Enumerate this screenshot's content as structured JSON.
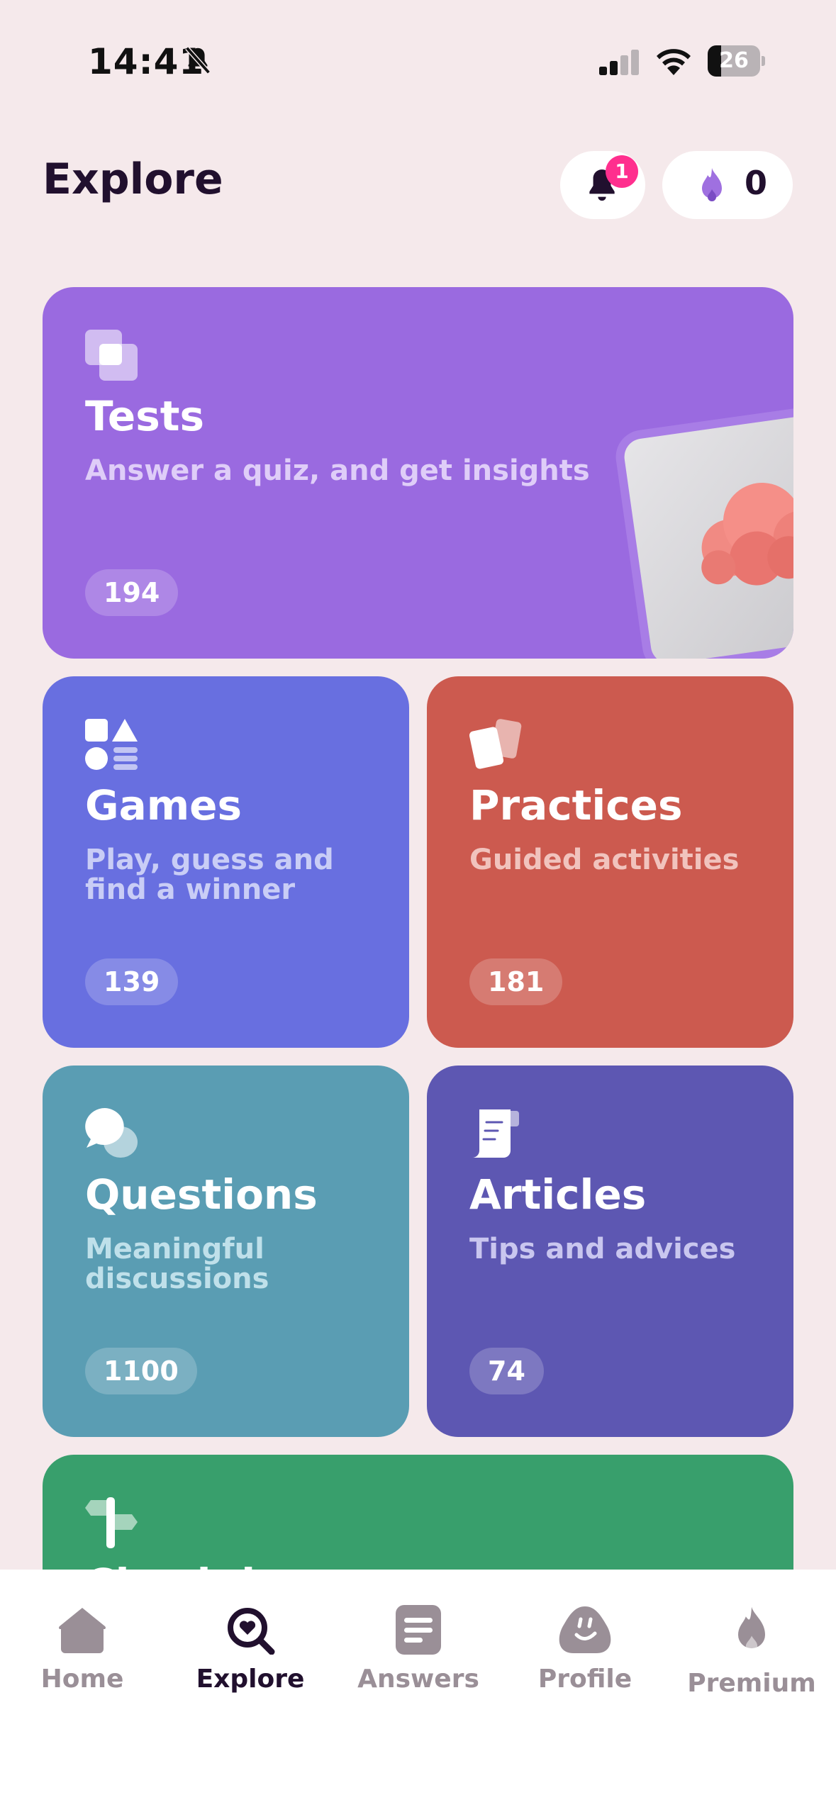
{
  "status_bar": {
    "time": "14:41",
    "battery_level": "26",
    "battery_fraction": 0.26
  },
  "header": {
    "title": "Explore",
    "notification_count": "1",
    "flame_count": "0"
  },
  "cards": {
    "tests": {
      "title": "Tests",
      "subtitle": "Answer a quiz, and get insights",
      "count": "194",
      "color": "#9a6ae0"
    },
    "games": {
      "title": "Games",
      "subtitle_line1": "Play, guess and",
      "subtitle_line2": "find a winner",
      "count": "139",
      "color": "#686fe0"
    },
    "practices": {
      "title": "Practices",
      "subtitle": "Guided activities",
      "count": "181",
      "color": "#cc5a4f"
    },
    "questions": {
      "title": "Questions",
      "subtitle_line1": "Meaningful",
      "subtitle_line2": "discussions",
      "count": "1100",
      "color": "#5a9db3"
    },
    "articles": {
      "title": "Articles",
      "subtitle": "Tips and advices",
      "count": "74",
      "color": "#5d57b2"
    },
    "checkins": {
      "title": "Check-ins",
      "color": "#389f6c"
    }
  },
  "tabs": [
    {
      "label": "Home",
      "icon": "home-icon"
    },
    {
      "label": "Explore",
      "icon": "explore-icon",
      "active": true
    },
    {
      "label": "Answers",
      "icon": "answers-icon"
    },
    {
      "label": "Profile",
      "icon": "profile-icon"
    },
    {
      "label": "Premium",
      "icon": "premium-flame-icon"
    }
  ],
  "colors": {
    "accent": "#21102e",
    "badge": "#ff2f8e",
    "background": "#f5e9eb",
    "tab_inactive": "#9a8f97"
  }
}
